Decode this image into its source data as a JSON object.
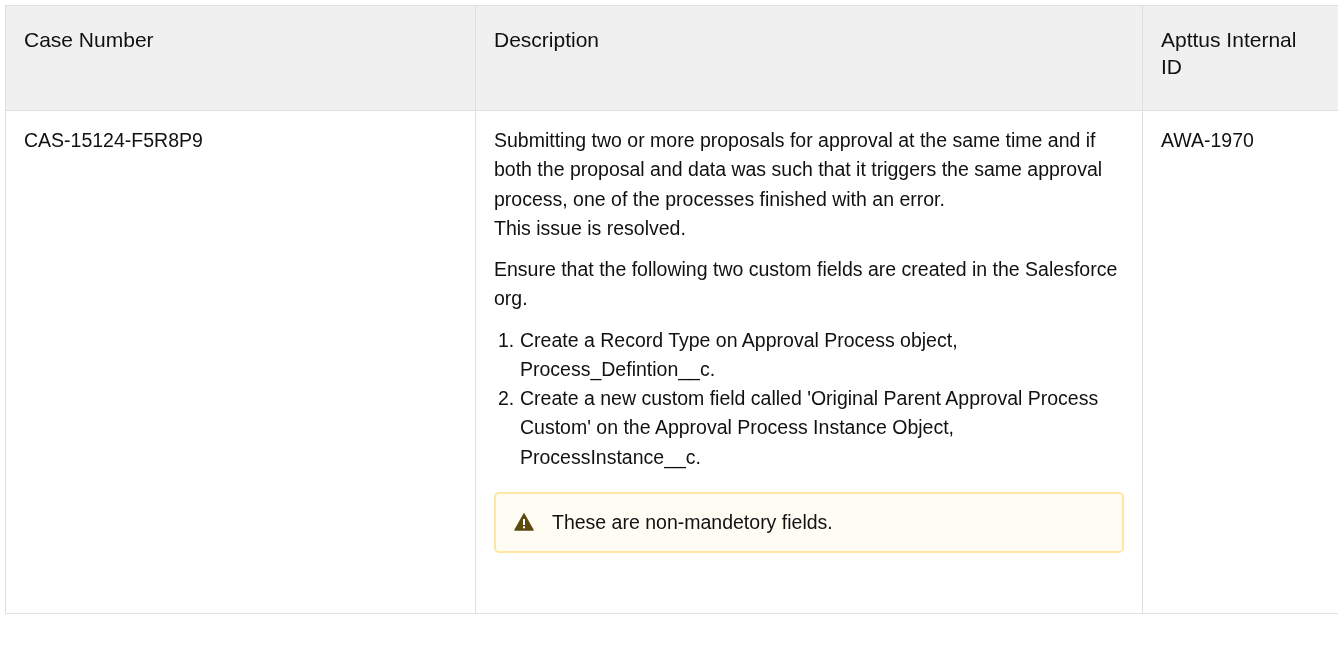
{
  "table": {
    "columns": [
      "Case Number",
      "Description",
      "Apttus Internal ID"
    ],
    "rows": [
      {
        "case_number": "CAS-15124-F5R8P9",
        "apttus_internal_id": "AWA-1970",
        "description": {
          "paragraphs": [
            {
              "lines": [
                "Submitting two or more proposals for approval at the same time and if both the proposal and data was such that it triggers the same approval process, one of the processes finished with an error.",
                "This issue is resolved."
              ]
            },
            {
              "lines": [
                "Ensure that the following two custom fields are created in the Salesforce org."
              ]
            }
          ],
          "steps": [
            {
              "marker": "1.",
              "text": "Create a Record Type on Approval Process object, Process_Defintion__c."
            },
            {
              "marker": "2.",
              "text": "Create a new custom field called 'Original Parent Approval Process Custom' on the Approval Process Instance Object, ProcessInstance__c."
            }
          ],
          "note": {
            "kind": "warning",
            "text": "These are non-mandetory fields."
          }
        }
      }
    ]
  }
}
